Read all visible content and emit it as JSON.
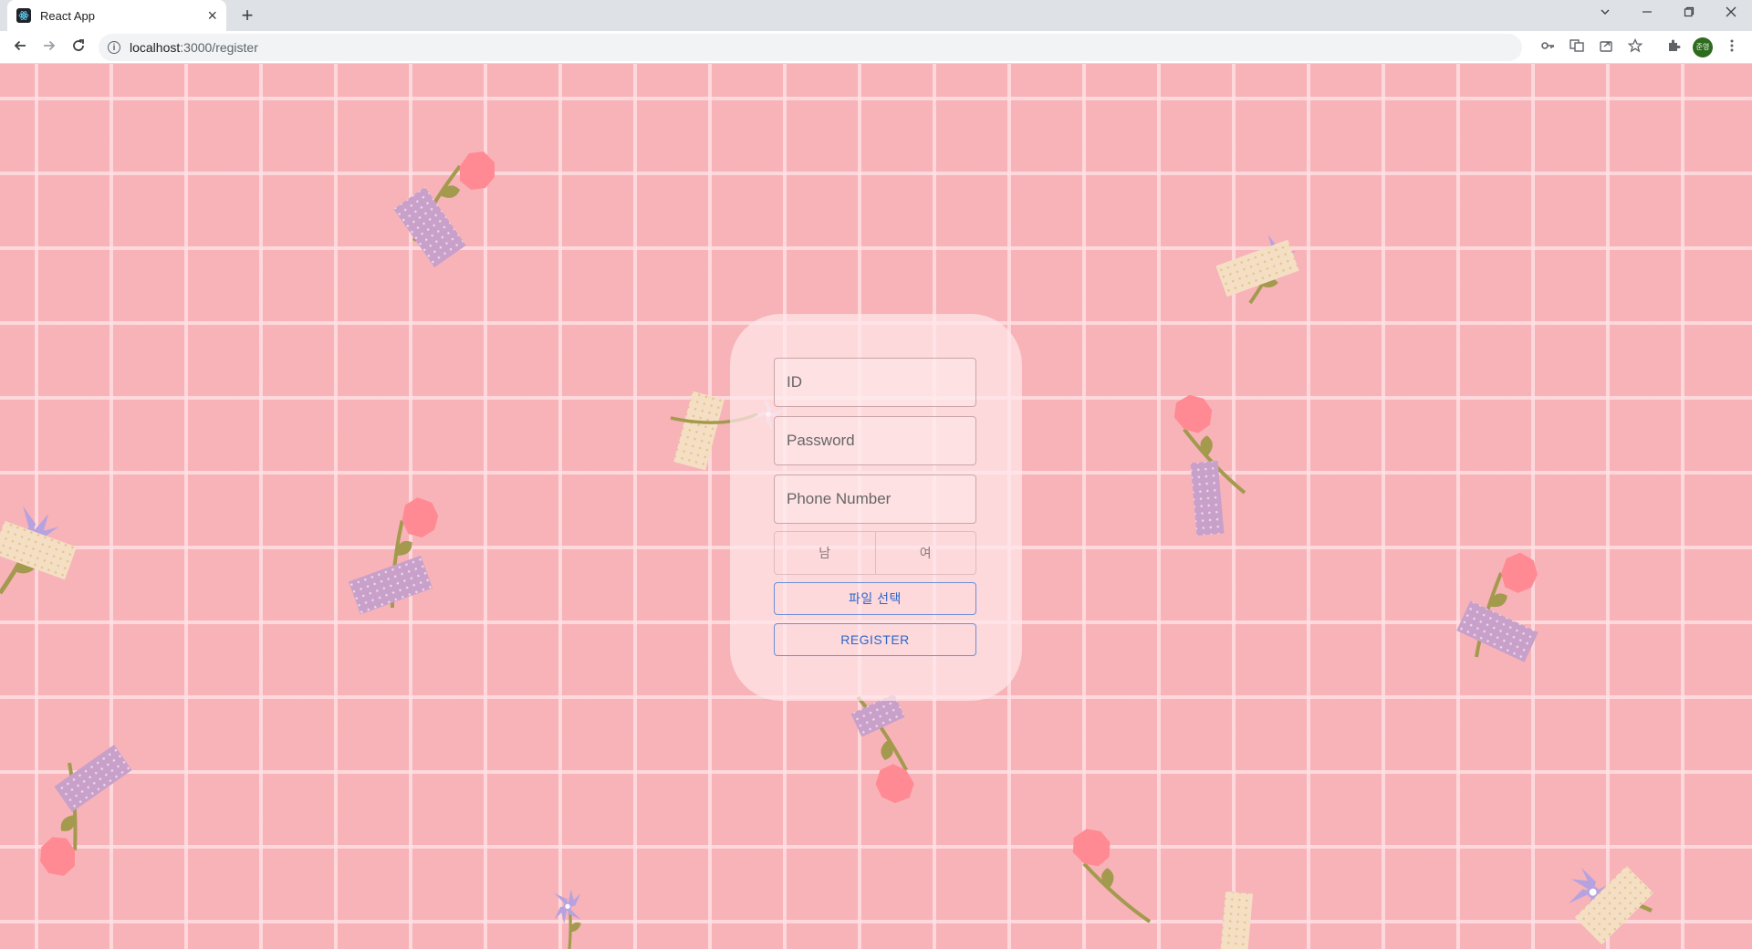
{
  "browser": {
    "tab_title": "React App",
    "tab_close": "×",
    "new_tab": "+",
    "url_host": "localhost",
    "url_path": ":3000/register",
    "avatar_text": "준영",
    "icons": [
      "back-arrow-icon",
      "forward-arrow-icon",
      "reload-icon",
      "info-icon",
      "key-icon",
      "translate-icon",
      "share-icon",
      "star-icon",
      "puzzle-icon",
      "kebab-menu-icon",
      "tab-search-icon",
      "minimize-icon",
      "restore-icon",
      "close-icon"
    ]
  },
  "form": {
    "id_placeholder": "ID",
    "password_placeholder": "Password",
    "phone_placeholder": "Phone Number",
    "gender_male": "남",
    "gender_female": "여",
    "file_button": "파일 선택",
    "register_button": "REGISTER"
  },
  "colors": {
    "background": "#f7b3b8",
    "grid_lines": "#ffe1e4",
    "card": "#ffe7ea",
    "button_outline": "#6a8fd6",
    "button_text": "#2f66c9",
    "flower_red": "#ff8a93",
    "flower_purple": "#b6a2df",
    "tape_purple": "#c8a0c9",
    "tape_cream": "#f5dfc4",
    "stem": "#a39a4e"
  }
}
